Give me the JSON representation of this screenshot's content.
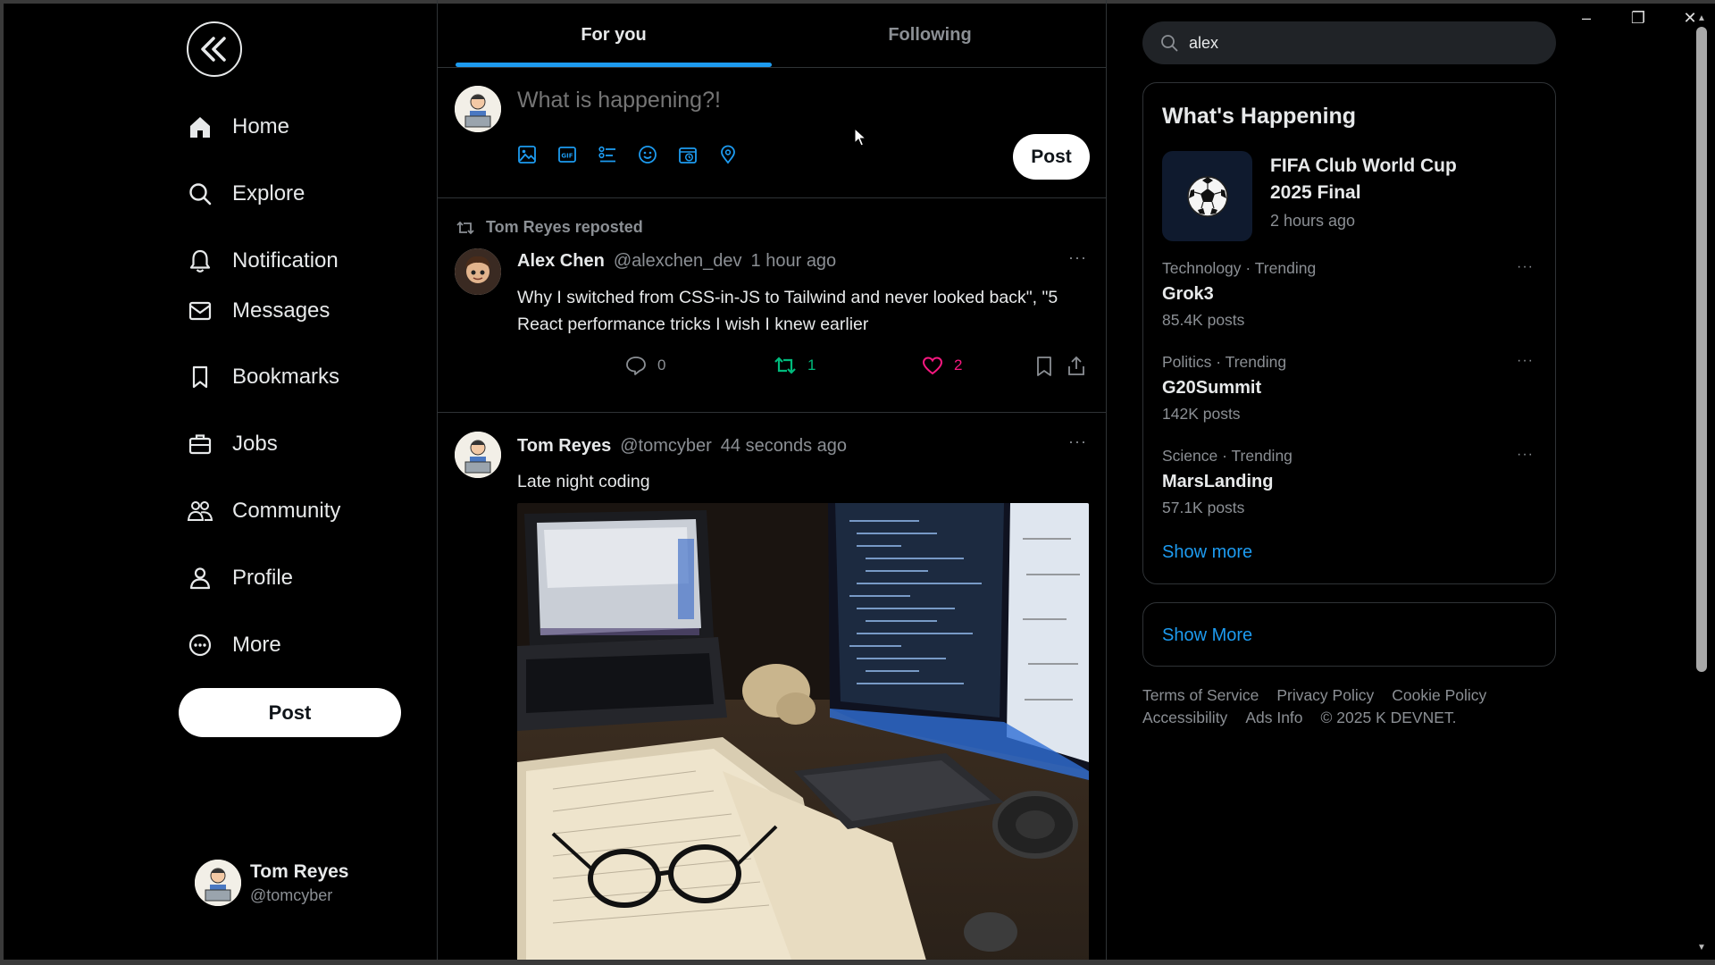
{
  "window": {
    "minimize": "–",
    "maximize": "❐",
    "close": "✕"
  },
  "sidebar": {
    "items": [
      {
        "label": "Home",
        "icon": "home-icon"
      },
      {
        "label": "Explore",
        "icon": "search-icon"
      },
      {
        "label": "Notification",
        "icon": "bell-icon"
      },
      {
        "label": "Messages",
        "icon": "mail-icon"
      },
      {
        "label": "Bookmarks",
        "icon": "bookmark-icon"
      },
      {
        "label": "Jobs",
        "icon": "briefcase-icon"
      },
      {
        "label": "Community",
        "icon": "people-icon"
      },
      {
        "label": "Profile",
        "icon": "person-icon"
      },
      {
        "label": "More",
        "icon": "more-circle-icon"
      }
    ],
    "post_label": "Post",
    "user": {
      "name": "Tom Reyes",
      "handle": "@tomcyber"
    }
  },
  "tabs": [
    {
      "label": "For you",
      "active": true
    },
    {
      "label": "Following",
      "active": false
    }
  ],
  "composer": {
    "placeholder": "What is happening?!",
    "tools": [
      "image-icon",
      "gif-icon",
      "poll-icon",
      "emoji-icon",
      "schedule-icon",
      "location-icon"
    ],
    "post_label": "Post"
  },
  "feed": [
    {
      "repost_by": "Tom Reyes reposted",
      "author": "Alex Chen",
      "handle": "@alexchen_dev",
      "time": "1 hour ago",
      "text": "Why I switched from CSS-in-JS to Tailwind and never looked back\", \"5 React performance tricks I wish I knew earlier",
      "replies": "0",
      "reposts": "1",
      "likes": "2",
      "more": "···"
    },
    {
      "author": "Tom Reyes",
      "handle": "@tomcyber",
      "time": "44 seconds ago",
      "text": "Late night coding",
      "more": "···"
    }
  ],
  "search": {
    "value": "alex"
  },
  "happening": {
    "title": "What's Happening",
    "featured": {
      "title": "FIFA Club World Cup 2025 Final",
      "time": "2 hours ago"
    },
    "trends": [
      {
        "meta": "Technology · Trending",
        "name": "Grok3",
        "count": "85.4K posts"
      },
      {
        "meta": "Politics · Trending",
        "name": "G20Summit",
        "count": "142K posts"
      },
      {
        "meta": "Science · Trending",
        "name": "MarsLanding",
        "count": "57.1K posts"
      }
    ],
    "show_more": "Show more"
  },
  "more_box": {
    "label": "Show More"
  },
  "footer": [
    "Terms of Service",
    "Privacy Policy",
    "Cookie Policy",
    "Accessibility",
    "Ads Info",
    "© 2025 K DEVNET."
  ],
  "colors": {
    "accent": "#1d9bf0",
    "repost": "#00ba7c",
    "like": "#f91880",
    "background": "#000000"
  }
}
